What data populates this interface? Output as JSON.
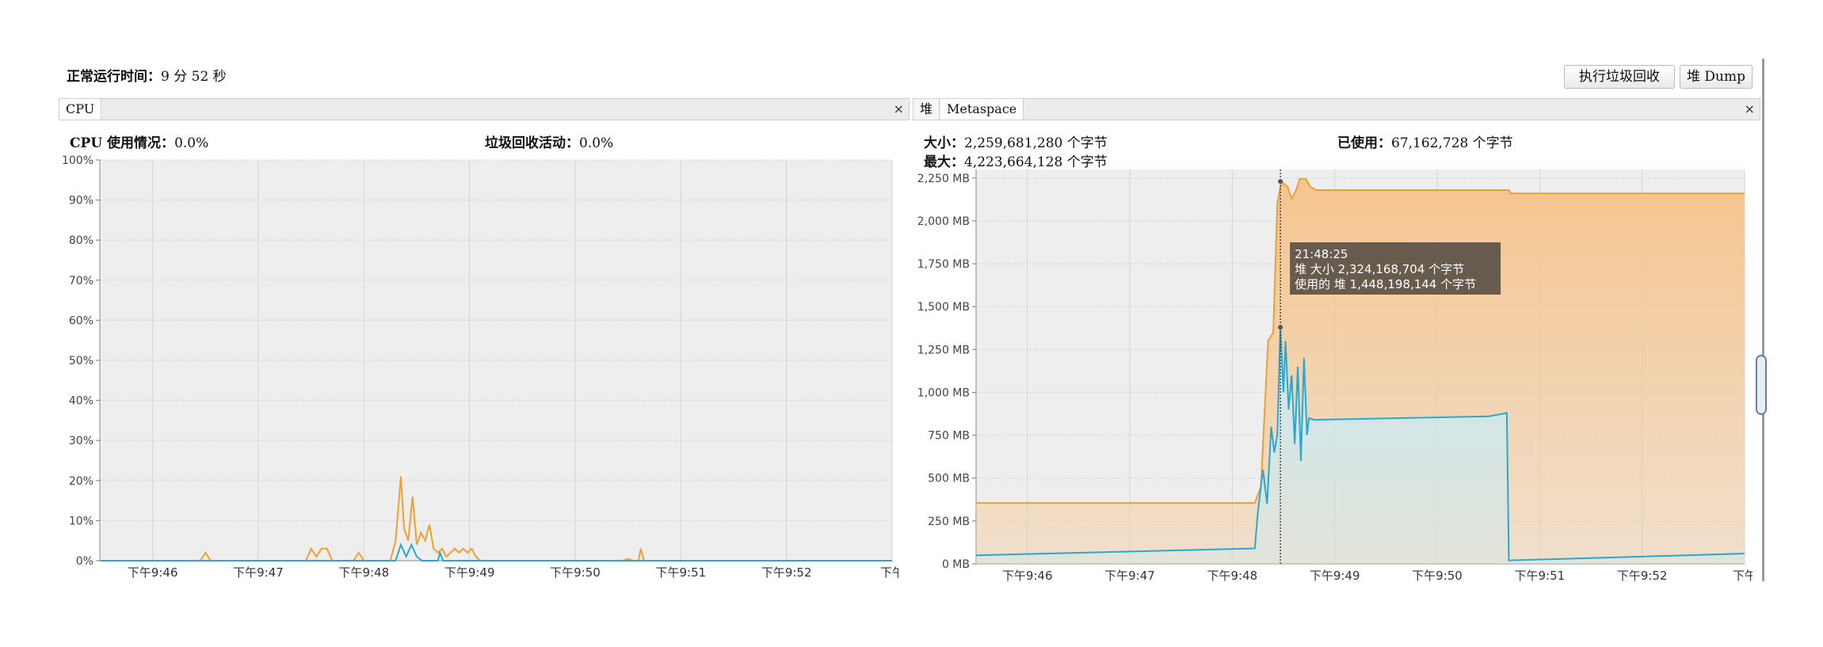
{
  "header": {
    "uptime_label": "正常运行时间：",
    "uptime_value": "9 分 52 秒",
    "gc_button": "执行垃圾回收",
    "heap_dump_button": "堆 Dump"
  },
  "cpu_panel": {
    "tab_label": "CPU",
    "close_glyph": "×",
    "usage_label": "CPU 使用情况：",
    "usage_value": "0.0%",
    "gc_activity_label": "垃圾回收活动：",
    "gc_activity_value": "0.0%"
  },
  "memory_panel": {
    "tab_heap": "堆",
    "tab_metaspace": "Metaspace",
    "close_glyph": "×",
    "size_label": "大小：",
    "size_value": "2,259,681,280 个字节",
    "max_label": "最大：",
    "max_value": "4,223,664,128 个字节",
    "used_label": "已使用：",
    "used_value": "67,162,728 个字节",
    "tooltip": {
      "time": "21:48:25",
      "heap_size_line": "堆 大小    2,324,168,704 个字节",
      "used_heap_line": "使用的 堆 1,448,198,144 个字节"
    }
  },
  "colors": {
    "series_orange": "#f0a030",
    "series_blue": "#29a8d0",
    "fill_orange": "#f6c58f",
    "fill_blue": "#c8ecf8",
    "plot_bg": "#eeeeee",
    "grid": "#d4d4d4"
  },
  "chart_data": [
    {
      "type": "line",
      "y_ticks": [
        "0%",
        "10%",
        "20%",
        "30%",
        "40%",
        "50%",
        "60%",
        "70%",
        "80%",
        "90%",
        "100%"
      ],
      "x_ticks": [
        "下午9:46",
        "下午9:47",
        "下午9:48",
        "下午9:49",
        "下午9:50",
        "下午9:51",
        "下午9:52",
        "下午"
      ],
      "ylim": [
        0,
        100
      ],
      "xlim": [
        0,
        7.5
      ],
      "series": [
        {
          "color": "#f0a030",
          "points": [
            [
              0,
              0
            ],
            [
              0.95,
              0
            ],
            [
              1.0,
              2
            ],
            [
              1.05,
              0
            ],
            [
              1.95,
              0
            ],
            [
              2.0,
              3
            ],
            [
              2.05,
              1
            ],
            [
              2.1,
              3
            ],
            [
              2.15,
              3
            ],
            [
              2.2,
              0
            ],
            [
              2.4,
              0
            ],
            [
              2.45,
              2
            ],
            [
              2.5,
              0
            ],
            [
              2.75,
              0
            ],
            [
              2.8,
              5
            ],
            [
              2.85,
              21
            ],
            [
              2.88,
              8
            ],
            [
              2.92,
              5
            ],
            [
              2.96,
              16
            ],
            [
              3.0,
              4
            ],
            [
              3.04,
              7
            ],
            [
              3.08,
              5
            ],
            [
              3.12,
              9
            ],
            [
              3.16,
              3
            ],
            [
              3.2,
              2
            ],
            [
              3.24,
              3
            ],
            [
              3.28,
              1
            ],
            [
              3.32,
              2
            ],
            [
              3.36,
              3
            ],
            [
              3.4,
              2
            ],
            [
              3.44,
              3
            ],
            [
              3.48,
              2
            ],
            [
              3.52,
              3
            ],
            [
              3.56,
              1
            ],
            [
              3.6,
              0
            ],
            [
              4.95,
              0
            ],
            [
              5.0,
              0.5
            ],
            [
              5.05,
              0
            ],
            [
              5.1,
              0
            ],
            [
              5.12,
              3
            ],
            [
              5.15,
              0
            ],
            [
              7.5,
              0
            ]
          ]
        },
        {
          "color": "#29a8d0",
          "points": [
            [
              0,
              0
            ],
            [
              2.8,
              0
            ],
            [
              2.85,
              4
            ],
            [
              2.9,
              1
            ],
            [
              2.95,
              4
            ],
            [
              3.0,
              1
            ],
            [
              3.05,
              0
            ],
            [
              3.2,
              0
            ],
            [
              3.22,
              2
            ],
            [
              3.25,
              0
            ],
            [
              7.5,
              0
            ]
          ]
        }
      ]
    },
    {
      "type": "area",
      "unit": "MB",
      "y_ticks": [
        "0 MB",
        "250 MB",
        "500 MB",
        "750 MB",
        "1,000 MB",
        "1,250 MB",
        "1,500 MB",
        "1,750 MB",
        "2,000 MB",
        "2,250 MB"
      ],
      "x_ticks": [
        "下午9:46",
        "下午9:47",
        "下午9:48",
        "下午9:49",
        "下午9:50",
        "下午9:51",
        "下午9:52",
        "下午"
      ],
      "ylim": [
        0,
        2300
      ],
      "xlim": [
        0,
        7.5
      ],
      "marker_x": 2.97,
      "series": [
        {
          "name": "堆 大小",
          "color": "#f0a030",
          "points": [
            [
              0,
              355
            ],
            [
              2.72,
              355
            ],
            [
              2.78,
              450
            ],
            [
              2.85,
              1300
            ],
            [
              2.9,
              1350
            ],
            [
              2.94,
              2100
            ],
            [
              2.98,
              2230
            ],
            [
              3.04,
              2200
            ],
            [
              3.08,
              2130
            ],
            [
              3.12,
              2175
            ],
            [
              3.16,
              2245
            ],
            [
              3.22,
              2245
            ],
            [
              3.26,
              2200
            ],
            [
              3.32,
              2180
            ],
            [
              5.2,
              2180
            ],
            [
              5.22,
              2160
            ],
            [
              7.5,
              2160
            ]
          ]
        },
        {
          "name": "使用的 堆",
          "color": "#29a8d0",
          "points": [
            [
              0,
              50
            ],
            [
              2.72,
              90
            ],
            [
              2.75,
              300
            ],
            [
              2.8,
              550
            ],
            [
              2.84,
              350
            ],
            [
              2.88,
              800
            ],
            [
              2.91,
              650
            ],
            [
              2.94,
              750
            ],
            [
              2.97,
              1380
            ],
            [
              3.0,
              1000
            ],
            [
              3.02,
              1300
            ],
            [
              3.05,
              900
            ],
            [
              3.08,
              1100
            ],
            [
              3.11,
              700
            ],
            [
              3.14,
              1150
            ],
            [
              3.17,
              600
            ],
            [
              3.2,
              1200
            ],
            [
              3.23,
              750
            ],
            [
              3.25,
              850
            ],
            [
              3.3,
              840
            ],
            [
              5.0,
              860
            ],
            [
              5.18,
              880
            ],
            [
              5.2,
              20
            ],
            [
              7.5,
              60
            ]
          ]
        }
      ]
    }
  ]
}
